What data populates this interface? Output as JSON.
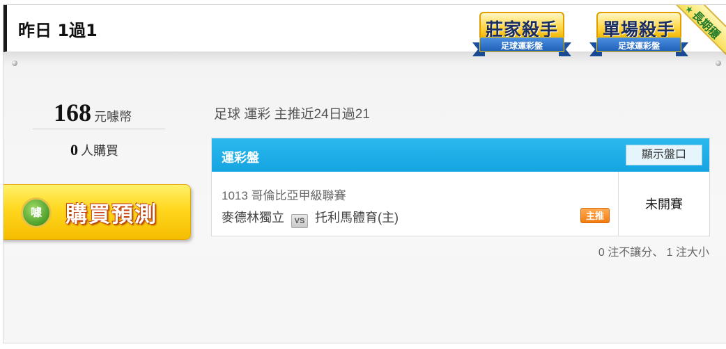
{
  "header": {
    "title": "昨日 1過1",
    "badges": [
      {
        "title": "莊家殺手",
        "ribbon": "足球運彩盤"
      },
      {
        "title": "單場殺手",
        "ribbon": "足球運彩盤"
      }
    ],
    "corner_label": "長期穩"
  },
  "purchase": {
    "price": "168",
    "currency": "元噱幣",
    "buyers": "0",
    "buyers_label": "人購買",
    "button_icon_text": "噱",
    "button_label": "購買預測"
  },
  "main": {
    "info": "足球 運彩 主推近24日過21",
    "panel": {
      "title": "運彩盤",
      "show_button": "顯示盤口",
      "game": {
        "code_league": "1013 哥倫比亞甲級聯賽",
        "team_away": "麥德林獨立",
        "vs": "VS",
        "team_home": "托利馬體育(主)",
        "tag": "主推",
        "status": "未開賽"
      }
    },
    "summary": "0 注不讓分、 1 注大小"
  },
  "colors": {
    "panel_header": "#14a4e0",
    "buy_button": "#ffd71e",
    "tag": "#f37c0e"
  }
}
